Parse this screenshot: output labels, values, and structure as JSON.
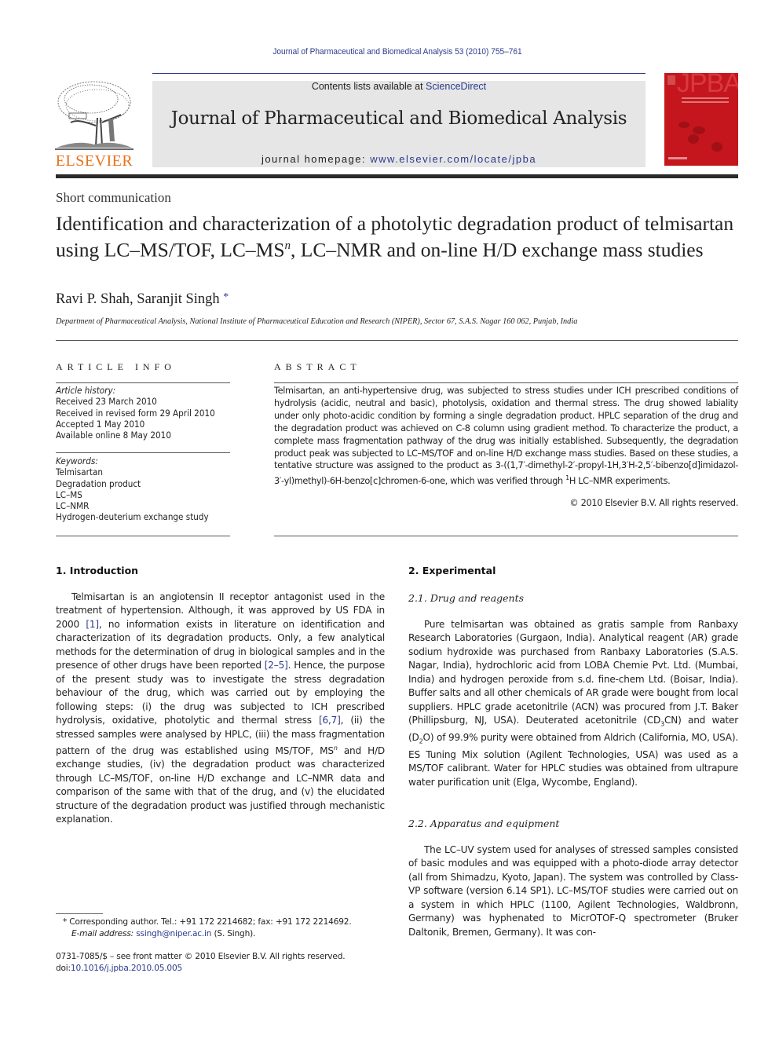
{
  "running_head": "Journal of Pharmaceutical and Biomedical Analysis 53 (2010) 755–761",
  "masthead": {
    "publisher_logo_text": "ELSEVIER",
    "contents_prefix": "Contents lists available at ",
    "contents_link": "ScienceDirect",
    "journal_title": "Journal of Pharmaceutical and Biomedical Analysis",
    "homepage_prefix": "journal homepage: ",
    "homepage_link": "www.elsevier.com/locate/jpba",
    "cover_title": "JPBA",
    "cover_color": "#c4161c",
    "logo_color": "#e8711a"
  },
  "article": {
    "type": "Short communication",
    "title_part1": "Identification and characterization of a photolytic degradation product of telmisartan using LC–MS/TOF, LC–MS",
    "title_sup": "n",
    "title_part2": ", LC–NMR and on-line H/D exchange mass studies",
    "authors": "Ravi P. Shah, Saranjit Singh",
    "author_marker": "*",
    "affiliation": "Department of Pharmaceutical Analysis, National Institute of Pharmaceutical Education and Research (NIPER), Sector 67, S.A.S. Nagar 160 062, Punjab, India"
  },
  "article_info": {
    "heading": "ARTICLE INFO",
    "history_label": "Article history:",
    "history": [
      "Received 23 March 2010",
      "Received in revised form 29 April 2010",
      "Accepted 1 May 2010",
      "Available online 8 May 2010"
    ],
    "keywords_label": "Keywords:",
    "keywords": [
      "Telmisartan",
      "Degradation product",
      "LC–MS",
      "LC–NMR",
      "Hydrogen-deuterium exchange study"
    ]
  },
  "abstract": {
    "heading": "ABSTRACT",
    "text_part1": "Telmisartan, an anti-hypertensive drug, was subjected to stress studies under ICH prescribed conditions of hydrolysis (acidic, neutral and basic), photolysis, oxidation and thermal stress. The drug showed labiality under only photo-acidic condition by forming a single degradation product. HPLC separation of the drug and the degradation product was achieved on C-8 column using gradient method. To characterize the product, a complete mass fragmentation pathway of the drug was initially established. Subsequently, the degradation product peak was subjected to LC–MS/TOF and on-line H/D exchange mass studies. Based on these studies, a tentative structure was assigned to the product as 3-((1,7′-dimethyl-2′-propyl-1H,3′H-2,5′-bibenzo[d]imidazol-3′-yl)methyl)-6H-benzo[c]chromen-6-one, which was verified through ",
    "text_sup": "1",
    "text_part2": "H LC–NMR experiments.",
    "copyright": "© 2010 Elsevier B.V. All rights reserved."
  },
  "introduction": {
    "heading": "1.  Introduction",
    "p1": "Telmisartan is an angiotensin II receptor antagonist used in the treatment of hypertension. Although, it was approved by US FDA in 2000 ",
    "ref1": "[1]",
    "p2": ", no information exists in literature on identification and characterization of its degradation products. Only, a few analytical methods for the determination of drug in biological samples and in the presence of other drugs have been reported ",
    "ref2": "[2–5]",
    "p3": ". Hence, the purpose of the present study was to investigate the stress degradation behaviour of the drug, which was carried out by employing the following steps: (i) the drug was subjected to ICH prescribed hydrolysis, oxidative, photolytic and thermal stress ",
    "ref3": "[6,7]",
    "p4": ", (ii) the stressed samples were analysed by HPLC, (iii) the mass fragmentation pattern of the drug was established using MS/TOF, MS",
    "sup": "n",
    "p5": " and H/D exchange studies, (iv) the degradation product was characterized through LC–MS/TOF, on-line H/D exchange and LC–NMR data and comparison of the same with that of the drug, and (v) the elucidated structure of the degradation product was justified through mechanistic explanation."
  },
  "experimental": {
    "heading": "2.  Experimental",
    "sub1_heading": "2.1.  Drug and reagents",
    "sub1_p1": "Pure telmisartan was obtained as gratis sample from Ranbaxy Research Laboratories (Gurgaon, India). Analytical reagent (AR) grade sodium hydroxide was purchased from Ranbaxy Laboratories (S.A.S. Nagar, India), hydrochloric acid from LOBA Chemie Pvt. Ltd. (Mumbai, India) and hydrogen peroxide from s.d. fine-chem Ltd. (Boisar, India). Buffer salts and all other chemicals of AR grade were bought from local suppliers. HPLC grade acetonitrile (ACN) was procured from J.T. Baker (Phillipsburg, NJ, USA). Deuterated acetonitrile (CD",
    "sub1_s1": "3",
    "sub1_p2": "CN) and water (D",
    "sub1_s2": "2",
    "sub1_p3": "O) of 99.9% purity were obtained from Aldrich (California, MO, USA). ES Tuning Mix solution (Agilent Technologies, USA) was used as a MS/TOF calibrant. Water for HPLC studies was obtained from ultrapure water purification unit (Elga, Wycombe, England).",
    "sub2_heading": "2.2.  Apparatus and equipment",
    "sub2_p1": "The LC–UV system used for analyses of stressed samples consisted of basic modules and was equipped with a photo-diode array detector (all from Shimadzu, Kyoto, Japan). The system was controlled by Class-VP software (version 6.14 SP1). LC–MS/TOF studies were carried out on a system in which HPLC (1100, Agilent Technologies, Waldbronn, Germany) was hyphenated to MicrOTOF-Q spectrometer (Bruker Daltonik, Bremen, Germany). It was con-"
  },
  "footnotes": {
    "corresponding": "* Corresponding author. Tel.: +91 172 2214682; fax: +91 172 2214692.",
    "email_label": "E-mail address:",
    "email": "ssingh@niper.ac.in",
    "email_suffix": " (S. Singh).",
    "issn": "0731-7085/$ – see front matter © 2010 Elsevier B.V. All rights reserved.",
    "doi_prefix": "doi:",
    "doi": "10.1016/j.jpba.2010.05.005"
  }
}
